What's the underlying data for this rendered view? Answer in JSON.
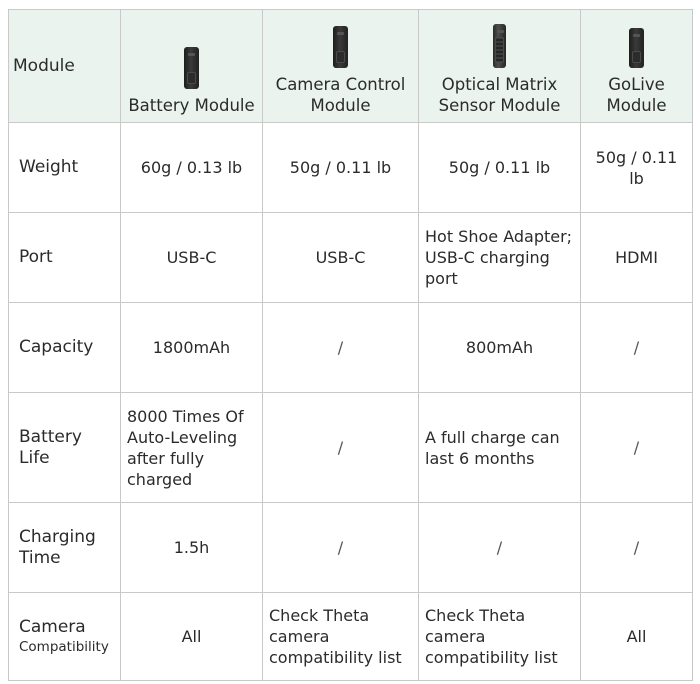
{
  "header": {
    "row_label": "Module",
    "products": [
      {
        "name": "Battery Module",
        "icon": "battery-module-device-icon"
      },
      {
        "name": "Camera Control Module",
        "icon": "camera-control-module-device-icon"
      },
      {
        "name": "Optical Matrix Sensor Module",
        "icon": "optical-matrix-sensor-module-device-icon"
      },
      {
        "name": "GoLive Module",
        "icon": "golive-module-device-icon"
      }
    ]
  },
  "rows": [
    {
      "label": "Weight",
      "cells": [
        "60g / 0.13 lb",
        "50g / 0.11 lb",
        "50g / 0.11 lb",
        "50g / 0.11 lb"
      ]
    },
    {
      "label": "Port",
      "cells": [
        "USB-C",
        "USB-C",
        "Hot Shoe Adapter; USB-C charging port",
        "HDMI"
      ]
    },
    {
      "label": "Capacity",
      "cells": [
        "1800mAh",
        "/",
        "800mAh",
        "/"
      ]
    },
    {
      "label": "Battery Life",
      "cells": [
        "8000 Times Of Auto-Leveling after fully charged",
        "/",
        "A full charge can last 6 months",
        "/"
      ]
    },
    {
      "label": "Charging Time",
      "cells": [
        "1.5h",
        "/",
        "/",
        "/"
      ]
    },
    {
      "label": "Camera",
      "label_small": "Compatibility",
      "cells": [
        "All",
        "Check Theta camera compatibility list",
        "Check Theta camera compatibility list",
        "All"
      ]
    }
  ],
  "colors": {
    "header_background": "#eaf3ee",
    "border": "#c9c9c9",
    "text": "#2b2b2b"
  }
}
